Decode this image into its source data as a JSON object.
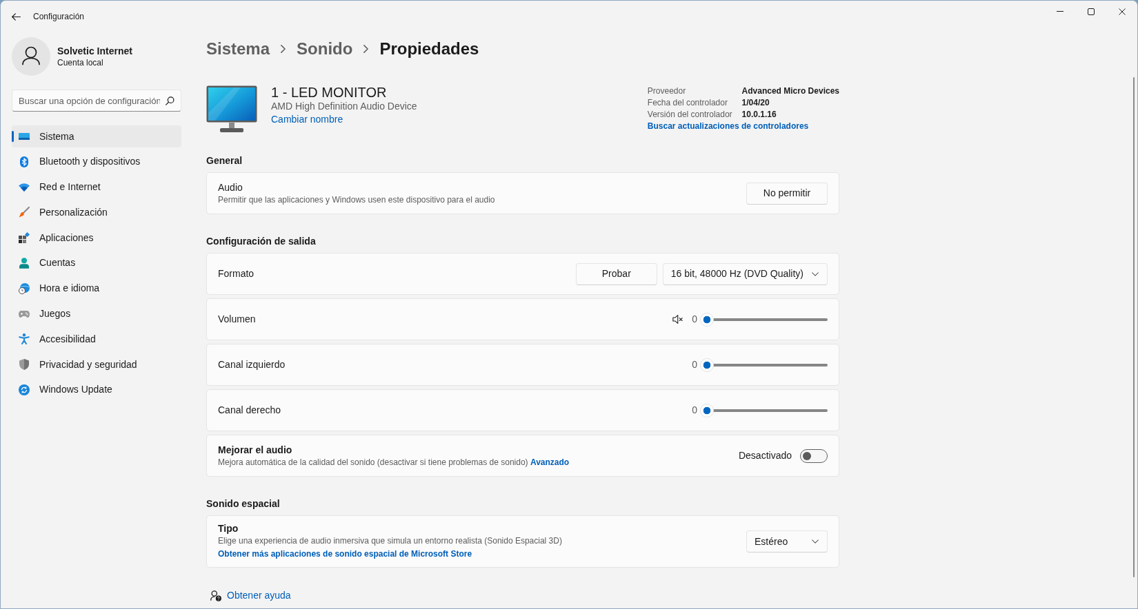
{
  "window": {
    "title": "Configuración"
  },
  "account": {
    "name": "Solvetic Internet",
    "type": "Cuenta local"
  },
  "search": {
    "placeholder": "Buscar una opción de configuración"
  },
  "sidebar": {
    "items": [
      {
        "label": "Sistema",
        "selected": true
      },
      {
        "label": "Bluetooth y dispositivos",
        "selected": false
      },
      {
        "label": "Red e Internet",
        "selected": false
      },
      {
        "label": "Personalización",
        "selected": false
      },
      {
        "label": "Aplicaciones",
        "selected": false
      },
      {
        "label": "Cuentas",
        "selected": false
      },
      {
        "label": "Hora e idioma",
        "selected": false
      },
      {
        "label": "Juegos",
        "selected": false
      },
      {
        "label": "Accesibilidad",
        "selected": false
      },
      {
        "label": "Privacidad y seguridad",
        "selected": false
      },
      {
        "label": "Windows Update",
        "selected": false
      }
    ]
  },
  "breadcrumb": [
    {
      "label": "Sistema",
      "current": false
    },
    {
      "label": "Sonido",
      "current": false
    },
    {
      "label": "Propiedades",
      "current": true
    }
  ],
  "device": {
    "name": "1 - LED MONITOR",
    "description": "AMD High Definition Audio Device",
    "link": "Cambiar nombre"
  },
  "driver": {
    "rows": [
      {
        "label": "Proveedor",
        "value": "Advanced Micro Devices"
      },
      {
        "label": "Fecha del controlador",
        "value": "1/04/20"
      },
      {
        "label": "Versión del controlador",
        "value": "10.0.1.16"
      }
    ],
    "link": "Buscar actualizaciones de controladores"
  },
  "sections": [
    {
      "title": "General",
      "cards": [
        {
          "kind": "button",
          "title": "Audio",
          "description": "Permitir que las aplicaciones y Windows usen este dispositivo para el audio",
          "button": "No permitir"
        }
      ]
    },
    {
      "title": "Configuración de salida",
      "cards": [
        {
          "kind": "format",
          "title": "Formato",
          "button": "Probar",
          "select": "16 bit, 48000 Hz (DVD Quality)"
        },
        {
          "kind": "slider",
          "title": "Volumen",
          "muted": true,
          "reading": "0",
          "level": 0
        },
        {
          "kind": "slider",
          "title": "Canal izquierdo",
          "reading": "0",
          "level": 0
        },
        {
          "kind": "slider",
          "title": "Canal derecho",
          "reading": "0",
          "level": 0
        },
        {
          "kind": "toggle",
          "title": "Mejorar el audio",
          "description": "Mejora automática de la calidad del sonido (desactivar si tiene problemas de sonido)",
          "link": "Avanzado",
          "state_label": "Desactivado",
          "on": false
        }
      ]
    },
    {
      "title": "Sonido espacial",
      "cards": [
        {
          "kind": "select",
          "title": "Tipo",
          "description": "Elige una experiencia de audio inmersiva que simula un entorno realista (Sonido Espacial 3D)",
          "link": "Obtener más aplicaciones de sonido espacial de Microsoft Store",
          "select": "Estéreo"
        }
      ]
    }
  ],
  "help": {
    "label": "Obtener ayuda"
  }
}
